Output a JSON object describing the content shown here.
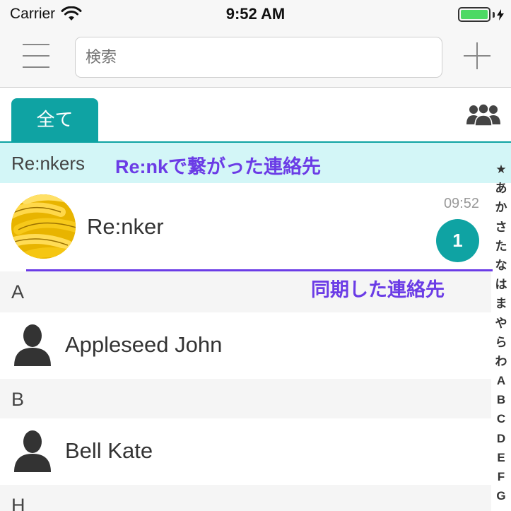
{
  "status_bar": {
    "carrier": "Carrier",
    "time": "9:52 AM",
    "battery_color": "#4cd964"
  },
  "nav": {
    "menu_icon": "hamburger-icon",
    "search_placeholder": "検索",
    "add_icon": "plus-icon"
  },
  "tabs": {
    "all_label": "全て",
    "accent_color": "#0fa3a3",
    "group_icon": "group-icon"
  },
  "renkers": {
    "header_label": "Re:nkers",
    "annotation": "Re:nkで繋がった連絡先",
    "row": {
      "name": "Re:nker",
      "time": "09:52",
      "unread_count": "1",
      "avatar": "banana-photo"
    }
  },
  "sync_annotation": "同期した連絡先",
  "annotation_color": "#6b3ce6",
  "sections": [
    {
      "letter": "A",
      "contacts": [
        "Appleseed John"
      ]
    },
    {
      "letter": "B",
      "contacts": [
        "Bell Kate"
      ]
    },
    {
      "letter": "H",
      "contacts": []
    }
  ],
  "index": [
    "★",
    "あ",
    "か",
    "さ",
    "た",
    "な",
    "は",
    "ま",
    "や",
    "ら",
    "わ",
    "A",
    "B",
    "C",
    "D",
    "E",
    "F",
    "G"
  ]
}
